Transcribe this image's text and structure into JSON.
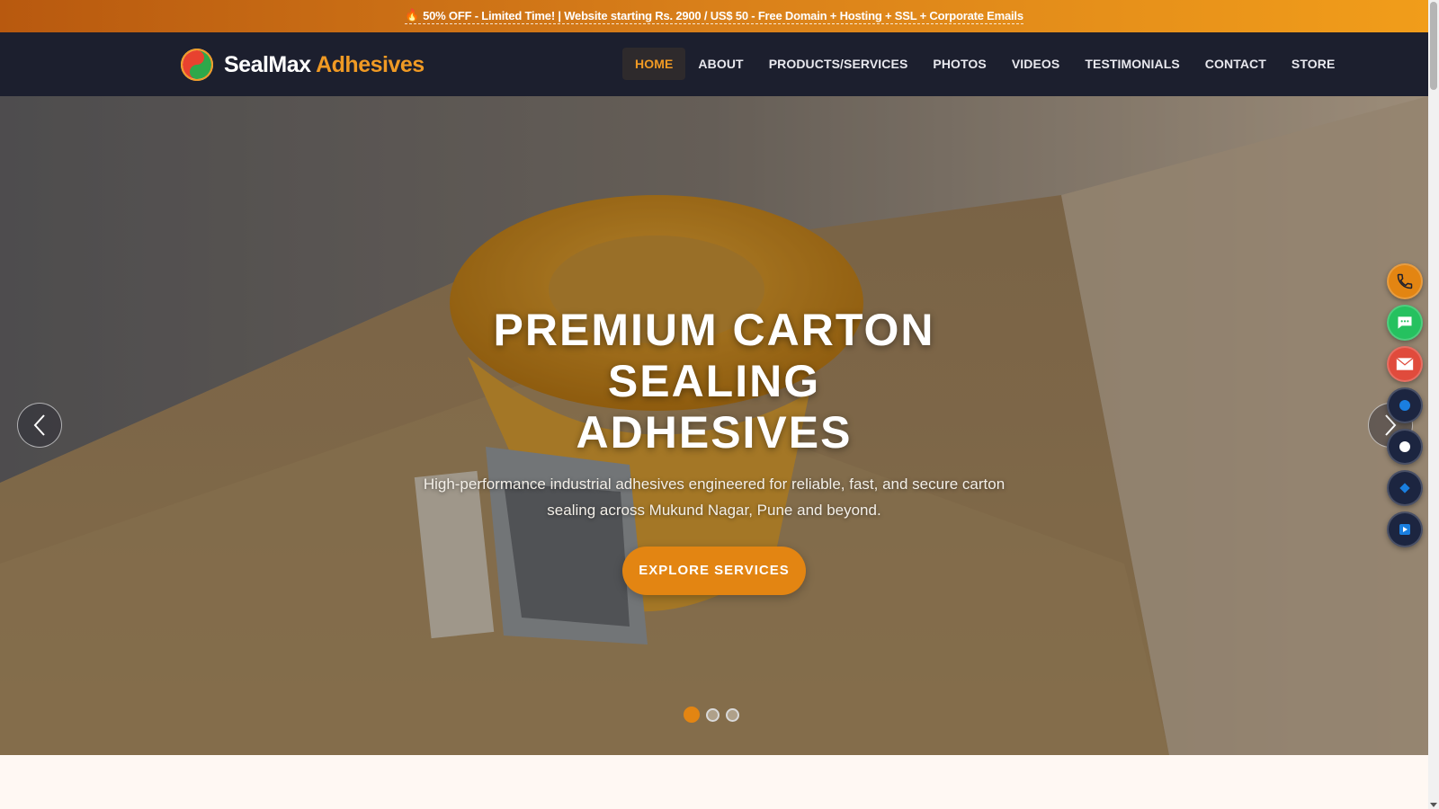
{
  "promo": {
    "icon": "fire-icon",
    "text": "50% OFF - Limited Time! | Website starting Rs. 2900 / US$ 50 - Free Domain + Hosting + SSL + Corporate Emails"
  },
  "brand": {
    "name_part1": "SealMax",
    "name_part2": "Adhesives",
    "accent_color": "#f09a24",
    "nav_bg": "#1c1f2e"
  },
  "nav": {
    "items": [
      {
        "label": "HOME",
        "active": true
      },
      {
        "label": "ABOUT",
        "active": false
      },
      {
        "label": "PRODUCTS/SERVICES",
        "active": false
      },
      {
        "label": "PHOTOS",
        "active": false
      },
      {
        "label": "VIDEOS",
        "active": false
      },
      {
        "label": "TESTIMONIALS",
        "active": false
      },
      {
        "label": "CONTACT",
        "active": false
      },
      {
        "label": "STORE",
        "active": false
      }
    ]
  },
  "hero": {
    "title_line1": "PREMIUM CARTON SEALING",
    "title_line2": "ADHESIVES",
    "subtitle": "High-performance industrial adhesives engineered for reliable, fast, and secure carton sealing across Mukund Nagar, Pune and beyond.",
    "cta_label": "EXPLORE SERVICES",
    "cta_color": "#e38512",
    "slide_count": 3,
    "active_slide": 1
  },
  "floating_actions": [
    {
      "name": "phone-icon",
      "color": "#e38512"
    },
    {
      "name": "chat-icon",
      "color": "#25c15f"
    },
    {
      "name": "mail-icon",
      "color": "#e04b3c"
    },
    {
      "name": "social-icon-1",
      "color": "#1c2540"
    },
    {
      "name": "social-icon-2",
      "color": "#1c2540"
    },
    {
      "name": "social-icon-3",
      "color": "#1c2540"
    },
    {
      "name": "video-icon",
      "color": "#1c2540"
    }
  ]
}
